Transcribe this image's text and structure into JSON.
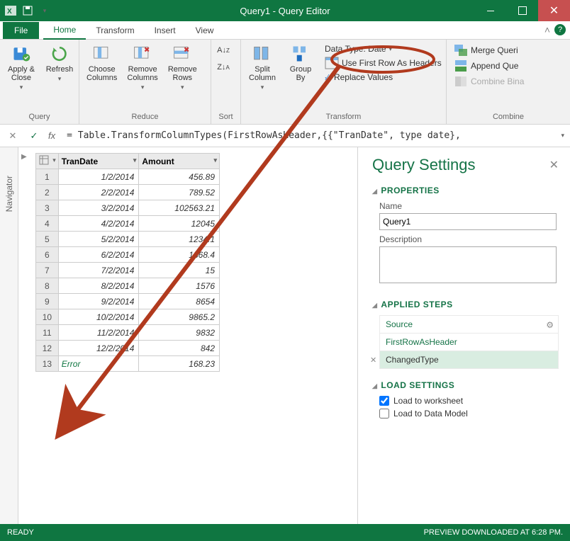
{
  "window_title": "Query1 - Query Editor",
  "tabs": {
    "file": "File",
    "home": "Home",
    "transform": "Transform",
    "insert": "Insert",
    "view": "View"
  },
  "ribbon": {
    "query": {
      "apply_close": "Apply &\nClose",
      "refresh": "Refresh",
      "group": "Query"
    },
    "reduce": {
      "choose_cols": "Choose\nColumns",
      "remove_cols": "Remove\nColumns",
      "remove_rows": "Remove\nRows",
      "group": "Reduce"
    },
    "sort": {
      "group": "Sort"
    },
    "transform": {
      "split_col": "Split\nColumn",
      "group_by": "Group\nBy",
      "data_type": "Data Type: Date",
      "first_row": "Use First Row As Headers",
      "replace": "Replace Values",
      "group": "Transform"
    },
    "combine": {
      "merge": "Merge Queri",
      "append": "Append Que",
      "combine_bin": "Combine Bina",
      "group": "Combine"
    }
  },
  "formula": "= Table.TransformColumnTypes(FirstRowAsHeader,{{\"TranDate\", type date},",
  "navigator": "Navigator",
  "columns": {
    "c1": "TranDate",
    "c2": "Amount"
  },
  "rows": [
    {
      "n": "1",
      "d": "1/2/2014",
      "a": "456.89"
    },
    {
      "n": "2",
      "d": "2/2/2014",
      "a": "789.52"
    },
    {
      "n": "3",
      "d": "3/2/2014",
      "a": "102563.21"
    },
    {
      "n": "4",
      "d": "4/2/2014",
      "a": "12045"
    },
    {
      "n": "5",
      "d": "5/2/2014",
      "a": "1234.1"
    },
    {
      "n": "6",
      "d": "6/2/2014",
      "a": "1568.4"
    },
    {
      "n": "7",
      "d": "7/2/2014",
      "a": "15"
    },
    {
      "n": "8",
      "d": "8/2/2014",
      "a": "1576"
    },
    {
      "n": "9",
      "d": "9/2/2014",
      "a": "8654"
    },
    {
      "n": "10",
      "d": "10/2/2014",
      "a": "9865.2"
    },
    {
      "n": "11",
      "d": "11/2/2014",
      "a": "9832"
    },
    {
      "n": "12",
      "d": "12/2/2014",
      "a": "842"
    }
  ],
  "error_row": {
    "n": "13",
    "d": "Error",
    "a": "168.23"
  },
  "settings": {
    "title": "Query Settings",
    "properties": "PROPERTIES",
    "name_label": "Name",
    "name_value": "Query1",
    "desc_label": "Description",
    "applied_steps": "APPLIED STEPS",
    "steps": {
      "source": "Source",
      "firstrow": "FirstRowAsHeader",
      "changed": "ChangedType"
    },
    "load": "LOAD SETTINGS",
    "load_ws": "Load to worksheet",
    "load_dm": "Load to Data Model"
  },
  "status": {
    "ready": "READY",
    "preview": "PREVIEW DOWNLOADED AT 6:28 PM."
  }
}
